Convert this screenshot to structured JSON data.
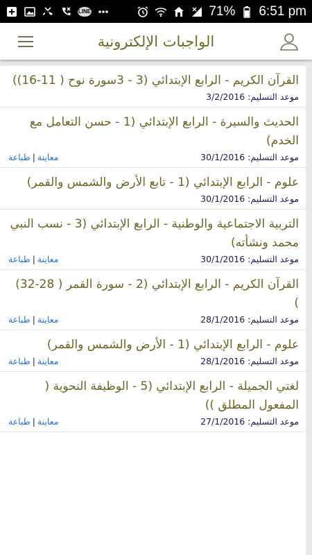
{
  "status_bar": {
    "battery": "71%",
    "time": "6:51 pm",
    "line_badge": "LINE"
  },
  "app_bar": {
    "title": "الواجبات الإلكترونية"
  },
  "due_label": "موعد التسليم:",
  "actions": {
    "preview": "معاينة",
    "separator": "|",
    "print": "طباعة"
  },
  "items": [
    {
      "title": "القرآن الكريم - الرابع الإبتدائي (3 - 3سورة نوح ( 11-16))",
      "due": "3/2/2016",
      "has_actions": false
    },
    {
      "title": "الحديث والسيرة - الرابع الإبتدائي (1 - حسن التعامل مع الخدم)",
      "due": "30/1/2016",
      "has_actions": true
    },
    {
      "title": "علوم - الرابع الإبتدائي (1 - تابع الأرض والشمس والقمر)",
      "due": "30/1/2016",
      "has_actions": false
    },
    {
      "title": "التربية الاجتماعية والوطنية - الرابع الإبتدائي (3 - نسب النبي محمد ونشأته)",
      "due": "30/1/2016",
      "has_actions": true
    },
    {
      "title": "القرآن الكريم - الرابع الإبتدائي (2 - سورة القمر ( 28-32) )",
      "due": "28/1/2016",
      "has_actions": true
    },
    {
      "title": "علوم - الرابع الإبتدائي (1 - الأرض والشمس والقمر)",
      "due": "28/1/2016",
      "has_actions": true
    },
    {
      "title": "لغتي الجميلة - الرابع الإبتدائي (5 - الوظيفة النحوية ( المفعول المطلق ))",
      "due": "27/1/2016",
      "has_actions": true
    }
  ]
}
